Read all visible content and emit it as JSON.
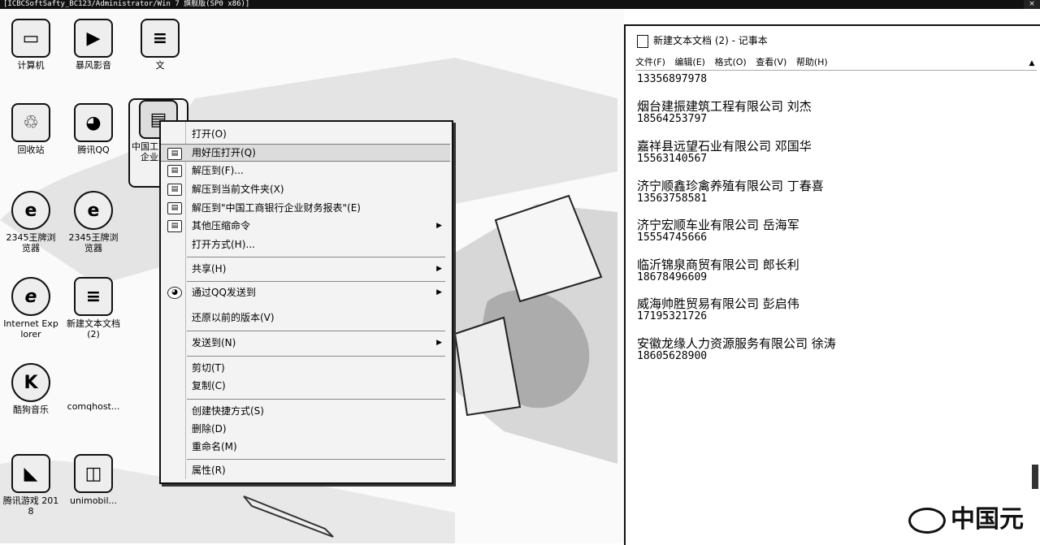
{
  "rdp": {
    "title": "[ICBCSoftSafty_BC123/Administrator/Win 7 旗舰版(SP0 x86)]",
    "close": "×"
  },
  "desktop": {
    "icons": [
      {
        "name": "computer-icon",
        "label": "计算机",
        "glyph": "▭"
      },
      {
        "name": "media-player-icon",
        "label": "暴风影音",
        "glyph": "▶"
      },
      {
        "name": "document-icon",
        "label": "文",
        "glyph": "≡"
      },
      {
        "name": "recycle-bin-icon",
        "label": "回收站",
        "glyph": "♲"
      },
      {
        "name": "qq-icon",
        "label": "腾讯QQ",
        "glyph": "◕"
      },
      {
        "name": "archive-icon",
        "label": "中国工商银行企业财务",
        "glyph": "▤"
      },
      {
        "name": "internet-explorer-icon",
        "label": "Internet Explorer",
        "glyph": "e"
      },
      {
        "name": "browser-icon-1",
        "label": "2345王牌浏览器",
        "glyph": "e"
      },
      {
        "name": "browser-icon-2",
        "label": "2345王牌浏览器",
        "glyph": "e"
      },
      {
        "name": "text-file-icon",
        "label": "新建文本文档(2)",
        "glyph": "≡"
      },
      {
        "name": "kugou-icon",
        "label": "酷狗音乐",
        "glyph": "K"
      },
      {
        "name": "commonhost-icon",
        "label": "comqhost...",
        "glyph": ""
      },
      {
        "name": "game-icon",
        "label": "腾讯游戏 2018",
        "glyph": "◣"
      },
      {
        "name": "unimobile-icon",
        "label": "unimobil...",
        "glyph": "◫"
      }
    ]
  },
  "context_menu": {
    "items": [
      {
        "label": "打开(O)",
        "icon": false,
        "arrow": false
      },
      {
        "label": "用好压打开(Q)",
        "icon": true,
        "arrow": false,
        "highlighted": true
      },
      {
        "label": "解压到(F)...",
        "icon": true,
        "arrow": false
      },
      {
        "label": "解压到当前文件夹(X)",
        "icon": true,
        "arrow": false
      },
      {
        "label": "解压到\"中国工商银行企业财务报表\"(E)",
        "icon": true,
        "arrow": false
      },
      {
        "label": "其他压缩命令",
        "icon": true,
        "arrow": true
      },
      {
        "label": "打开方式(H)...",
        "icon": false,
        "arrow": false
      },
      {
        "label": "共享(H)",
        "icon": false,
        "arrow": true
      },
      {
        "label": "通过QQ发送到",
        "icon": true,
        "arrow": true
      },
      {
        "label": "还原以前的版本(V)",
        "icon": false,
        "arrow": false
      },
      {
        "label": "发送到(N)",
        "icon": false,
        "arrow": true
      },
      {
        "label": "剪切(T)",
        "icon": false,
        "arrow": false
      },
      {
        "label": "复制(C)",
        "icon": false,
        "arrow": false
      },
      {
        "label": "创建快捷方式(S)",
        "icon": false,
        "arrow": false
      },
      {
        "label": "删除(D)",
        "icon": false,
        "arrow": false
      },
      {
        "label": "重命名(M)",
        "icon": false,
        "arrow": false
      },
      {
        "label": "属性(R)",
        "icon": false,
        "arrow": false
      }
    ],
    "arrow_glyph": "▶"
  },
  "notepad": {
    "title": "新建文本文档 (2) - 记事本",
    "menus": [
      "文件(F)",
      "编辑(E)",
      "格式(O)",
      "查看(V)",
      "帮助(H)"
    ],
    "scroll_glyph": "▲",
    "first_phone": "13356897978",
    "entries": [
      {
        "company": "烟台建振建筑工程有限公司 刘杰",
        "phone": "18564253797"
      },
      {
        "company": "嘉祥县远望石业有限公司 邓国华",
        "phone": "15563140567"
      },
      {
        "company": "济宁顺鑫珍禽养殖有限公司 丁春喜",
        "phone": "13563758581"
      },
      {
        "company": "济宁宏顺车业有限公司 岳海军",
        "phone": "15554745666"
      },
      {
        "company": "临沂锦泉商贸有限公司 郎长利",
        "phone": "18678496609"
      },
      {
        "company": "威海帅胜贸易有限公司 彭启伟",
        "phone": "17195321726"
      },
      {
        "company": "安徽龙缘人力资源服务有限公司 徐涛",
        "phone": "18605628900"
      }
    ]
  },
  "watermark": {
    "text": "中国元"
  }
}
